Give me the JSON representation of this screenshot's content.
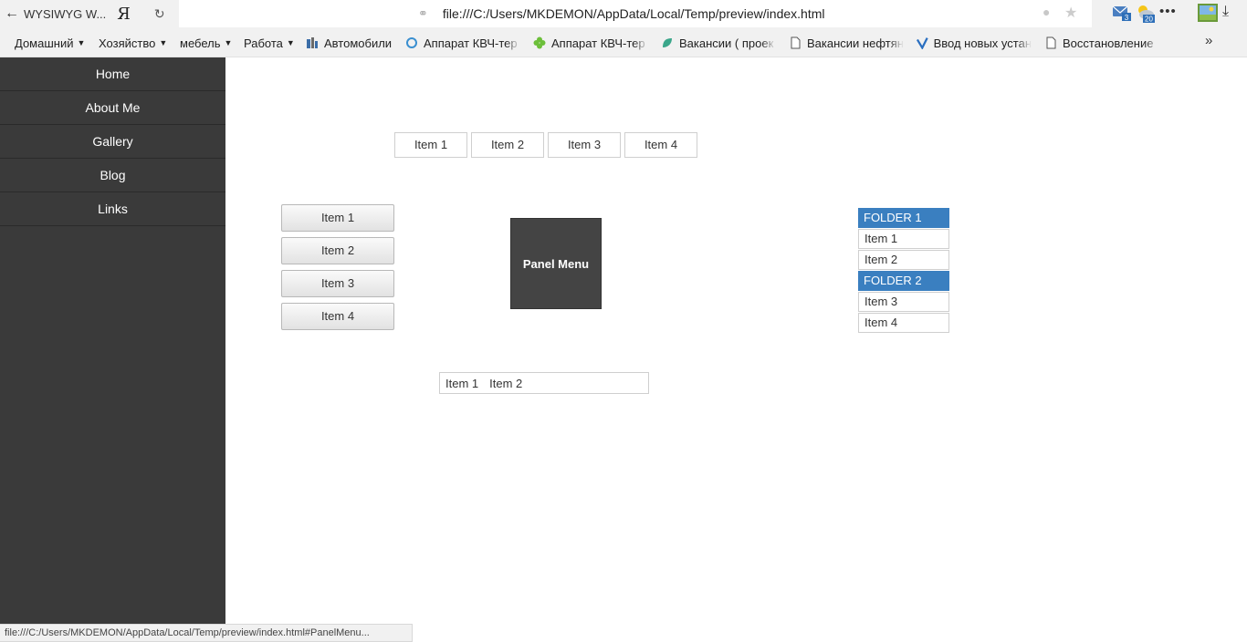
{
  "browser": {
    "tab_title": "WYSIWYG W...",
    "ya_label": "Я",
    "url": "file:///C:/Users/MKDEMON/AppData/Local/Temp/preview/index.html",
    "status_url": "file:///C:/Users/MKDEMON/AppData/Local/Temp/preview/index.html#PanelMenu...",
    "mail_badge": "3",
    "weather_badge": "20",
    "icons": [
      "back-arrow-icon",
      "yandex-icon",
      "reload-icon",
      "globe-icon",
      "bulb-icon",
      "star-icon",
      "mail-icon",
      "weather-icon",
      "more-icon",
      "picture-icon",
      "download-icon"
    ]
  },
  "bookmarks": [
    {
      "label": "Домашний",
      "folder": true
    },
    {
      "label": "Хозяйство",
      "folder": true
    },
    {
      "label": "мебель",
      "folder": true
    },
    {
      "label": "Работа",
      "folder": true
    },
    {
      "label": "Автомобили",
      "folder": false
    },
    {
      "label": "Аппарат КВЧ-тер",
      "folder": false
    },
    {
      "label": "Аппарат КВЧ-тер",
      "folder": false
    },
    {
      "label": "Вакансии ( проек",
      "folder": false
    },
    {
      "label": "Вакансии нефтян",
      "folder": false
    },
    {
      "label": "Ввод новых устан",
      "folder": false
    },
    {
      "label": "Восстановление",
      "folder": false
    }
  ],
  "bookmarks_more": "»",
  "sidebar": {
    "items": [
      {
        "label": "Home"
      },
      {
        "label": "About Me"
      },
      {
        "label": "Gallery"
      },
      {
        "label": "Blog"
      },
      {
        "label": "Links"
      }
    ]
  },
  "horizontal_menu": {
    "items": [
      {
        "label": "Item 1"
      },
      {
        "label": "Item 2"
      },
      {
        "label": "Item 3"
      },
      {
        "label": "Item 4"
      }
    ]
  },
  "vertical_menu": {
    "items": [
      {
        "label": "Item 1"
      },
      {
        "label": "Item 2"
      },
      {
        "label": "Item 3"
      },
      {
        "label": "Item 4"
      }
    ]
  },
  "panel_menu": {
    "label": "Panel Menu"
  },
  "tree_menu": {
    "folder1": "FOLDER 1",
    "folder1_items": [
      "Item 1",
      "Item 2"
    ],
    "folder2": "FOLDER 2",
    "folder2_items": [
      "Item 3",
      "Item 4"
    ]
  },
  "menubar": {
    "items": [
      {
        "label": "Item 1"
      },
      {
        "label": "Item 2"
      }
    ]
  },
  "colors": {
    "sidebar_bg": "#3a3a3a",
    "folder_bg": "#3a7fc0",
    "panel_bg": "#444444"
  }
}
